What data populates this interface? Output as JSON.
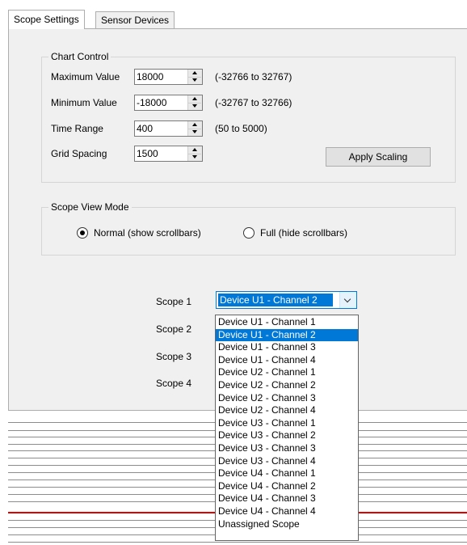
{
  "tabs": [
    {
      "label": "Scope Settings",
      "active": true
    },
    {
      "label": "Sensor Devices",
      "active": false
    }
  ],
  "chart_control": {
    "title": "Chart Control",
    "rows": [
      {
        "label": "Maximum Value",
        "value": "18000",
        "range": "(-32766 to 32767)"
      },
      {
        "label": "Minimum Value",
        "value": "-18000",
        "range": "(-32767 to 32766)"
      },
      {
        "label": "Time Range",
        "value": "400",
        "range": "(50 to 5000)"
      },
      {
        "label": "Grid Spacing",
        "value": "1500",
        "range": ""
      }
    ],
    "apply_label": "Apply Scaling"
  },
  "view_mode": {
    "title": "Scope View Mode",
    "options": [
      {
        "label": "Normal (show scrollbars)",
        "selected": true
      },
      {
        "label": "Full (hide scrollbars)",
        "selected": false
      }
    ]
  },
  "scopes": {
    "labels": [
      "Scope 1",
      "Scope 2",
      "Scope 3",
      "Scope 4"
    ],
    "scope1_value": "Device U1 - Channel 2"
  },
  "dropdown": {
    "options": [
      "Device U1 - Channel 1",
      "Device U1 - Channel 2",
      "Device U1 - Channel 3",
      "Device U1 - Channel 4",
      "Device U2 - Channel 1",
      "Device U2 - Channel 2",
      "Device U2 - Channel 3",
      "Device U2 - Channel 4",
      "Device U3 - Channel 1",
      "Device U3 - Channel 2",
      "Device U3 - Channel 3",
      "Device U3 - Channel 4",
      "Device U4 - Channel 1",
      "Device U4 - Channel 2",
      "Device U4 - Channel 3",
      "Device U4 - Channel 4",
      "Unassigned Scope"
    ],
    "selected_index": 1
  },
  "colors": {
    "selection": "#0078d7",
    "trace": "#e00000",
    "panel": "#f0f0f0"
  }
}
